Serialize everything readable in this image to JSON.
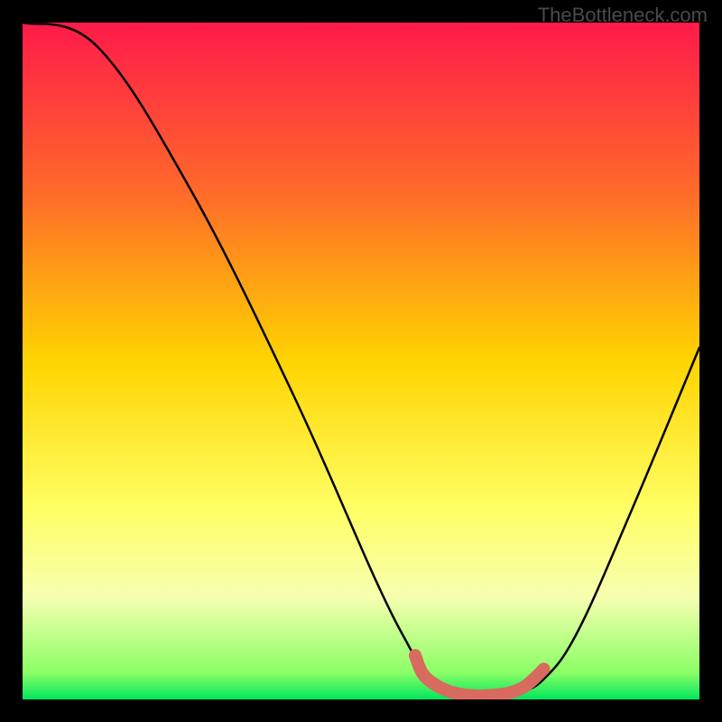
{
  "watermark": "TheBottleneck.com",
  "chart_data": {
    "type": "line",
    "title": "",
    "xlabel": "",
    "ylabel": "",
    "xlim": [
      0,
      100
    ],
    "ylim": [
      0,
      100
    ],
    "grid": false,
    "background_gradient": {
      "stops": [
        {
          "offset": 0,
          "color": "#ff1a4a"
        },
        {
          "offset": 25,
          "color": "#ff6a2a"
        },
        {
          "offset": 50,
          "color": "#ffd400"
        },
        {
          "offset": 72,
          "color": "#ffff66"
        },
        {
          "offset": 85,
          "color": "#f5ffb0"
        },
        {
          "offset": 96,
          "color": "#8cff66"
        },
        {
          "offset": 100,
          "color": "#00e65c"
        }
      ]
    },
    "series": [
      {
        "name": "bottleneck-curve",
        "points": [
          {
            "x": 0,
            "y": 100
          },
          {
            "x": 11,
            "y": 96.5
          },
          {
            "x": 25,
            "y": 75
          },
          {
            "x": 40,
            "y": 45
          },
          {
            "x": 52,
            "y": 18
          },
          {
            "x": 57,
            "y": 8
          },
          {
            "x": 60,
            "y": 3
          },
          {
            "x": 63,
            "y": 1
          },
          {
            "x": 68,
            "y": 0.5
          },
          {
            "x": 73,
            "y": 1
          },
          {
            "x": 77,
            "y": 3
          },
          {
            "x": 82,
            "y": 10
          },
          {
            "x": 90,
            "y": 28
          },
          {
            "x": 100,
            "y": 52
          }
        ]
      }
    ],
    "highlight": {
      "name": "optimal-range",
      "color": "#d86a60",
      "points": [
        {
          "x": 58,
          "y": 6.5
        },
        {
          "x": 59,
          "y": 4
        },
        {
          "x": 60.5,
          "y": 2.5
        },
        {
          "x": 63,
          "y": 1.2
        },
        {
          "x": 66,
          "y": 0.6
        },
        {
          "x": 69,
          "y": 0.6
        },
        {
          "x": 72,
          "y": 1
        },
        {
          "x": 74,
          "y": 1.8
        },
        {
          "x": 75.5,
          "y": 3
        },
        {
          "x": 77,
          "y": 4.5
        }
      ]
    }
  }
}
